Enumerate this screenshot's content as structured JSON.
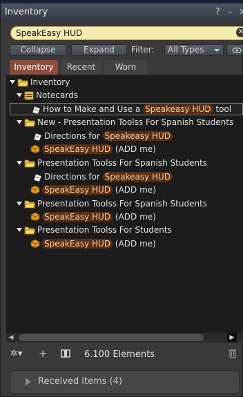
{
  "window": {
    "title": "Inventory",
    "controls": [
      "?",
      "–",
      "×"
    ]
  },
  "search": {
    "value": "SpeakEasy HUD",
    "clear_glyph": "✕"
  },
  "toolbar": {
    "collapse_label": "Collapse",
    "expand_label": "Expand",
    "filter_label": "Filter:",
    "filter_value": "All Types"
  },
  "tabs": [
    {
      "label": "Inventory",
      "active": true
    },
    {
      "label": "Recent",
      "active": false
    },
    {
      "label": "Worn",
      "active": false
    }
  ],
  "tree": {
    "root": "Inventory",
    "notecards": "Notecards",
    "nc_item_pre": "How to Make and Use a",
    "nc_item_hl": "Speakeasy HUD",
    "nc_item_post": "tool",
    "folder1": "New - Presentation Toolss For Spanish Students",
    "directions_pre": "Directions for",
    "directions_hl": "Speakeasy HUD",
    "hud_hl": "SpeakEasy HUD",
    "hud_post": "(ADD me)",
    "folder2": "Presentation Toolss For Spanish Students",
    "folder3": "Presentation Toolss For Spanish Students",
    "folder4": "Presentation Toolss For Students"
  },
  "bottom": {
    "item_count": "6.100 Elements",
    "icons": [
      "gear-icon",
      "plus-icon",
      "new-folder-icon",
      "trash-icon"
    ]
  },
  "received": {
    "label": "Received items (4)"
  },
  "colors": {
    "highlight_bg": "#5a2f18",
    "highlight_text": "#ffcc99",
    "active_tab": "#8d4d3a",
    "search_bg": "#f3eab0",
    "folder": "#e8c34a"
  }
}
